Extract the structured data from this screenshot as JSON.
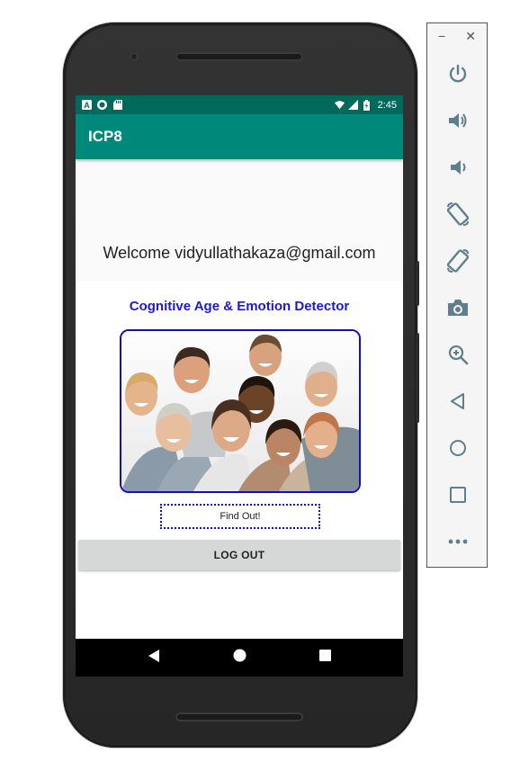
{
  "status_bar": {
    "left_icons": [
      "a-icon",
      "circle-icon",
      "sd-card-icon"
    ],
    "a_glyph": "A",
    "right_icons": [
      "wifi-icon",
      "signal-icon",
      "battery-icon"
    ],
    "time": "2:45"
  },
  "app_bar": {
    "title": "ICP8"
  },
  "main": {
    "welcome_text": "Welcome vidyullathakaza@gmail.com",
    "heading": "Cognitive Age & Emotion Detector",
    "find_button": "Find Out!",
    "logout_button": "LOG OUT"
  },
  "nav_bar": {
    "icons": [
      "back-icon",
      "home-icon",
      "recents-icon"
    ]
  },
  "emulator_toolbar": {
    "window_controls": {
      "minimize": "−",
      "close": "✕"
    },
    "buttons": [
      "power-icon",
      "volume-up-icon",
      "volume-down-icon",
      "rotate-left-icon",
      "rotate-right-icon",
      "camera-icon",
      "zoom-icon",
      "back-icon",
      "home-icon",
      "overview-icon",
      "more-icon"
    ]
  },
  "colors": {
    "status_bar": "#00695c",
    "app_bar": "#00897b",
    "heading": "#1a1ad6",
    "border_blue": "#1010c0",
    "toolbar_icon": "#5f7f8f"
  }
}
